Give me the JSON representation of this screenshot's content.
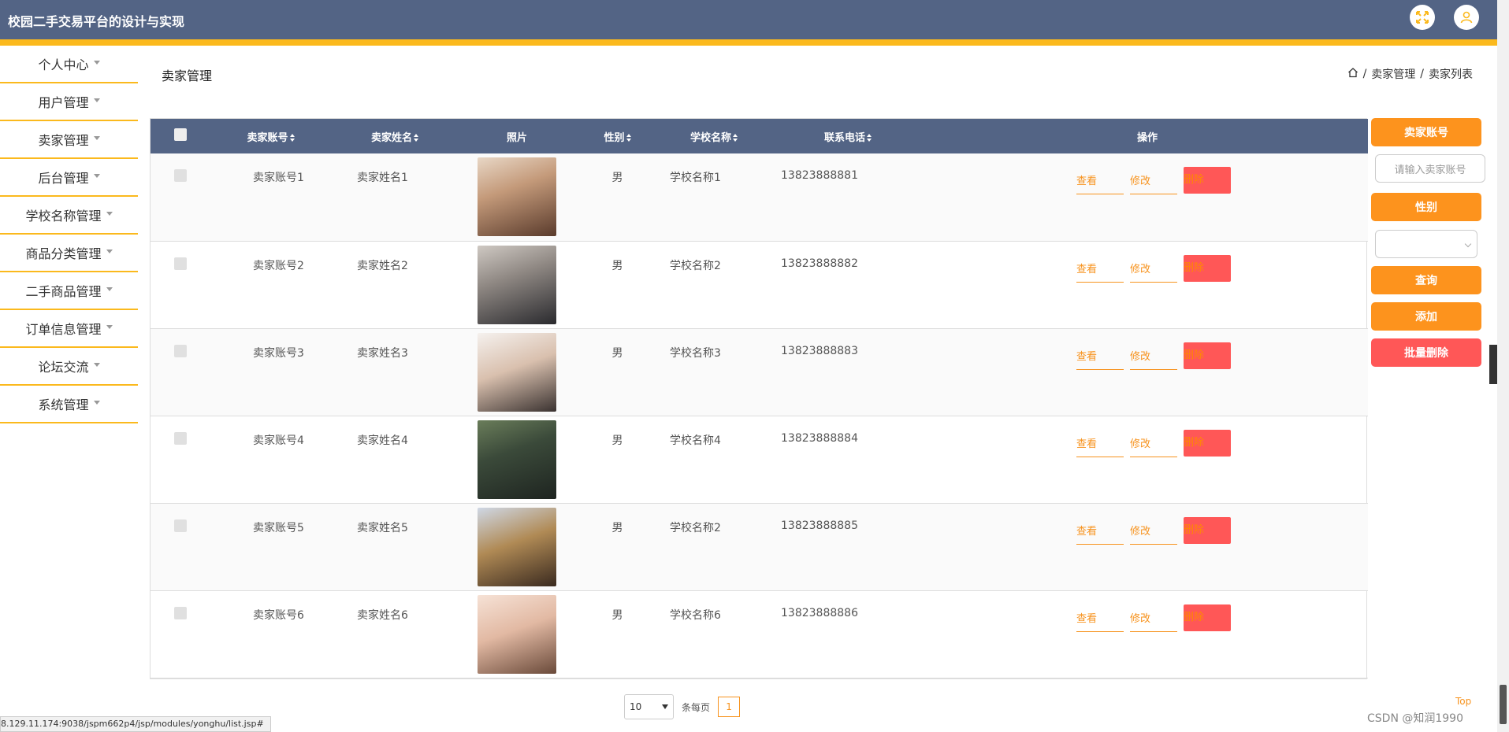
{
  "app": {
    "title": "校园二手交易平台的设计与实现"
  },
  "colors": {
    "header_bg": "#536485",
    "accent": "#fbb91d",
    "orange": "#fd931d",
    "danger": "#ff5757"
  },
  "header": {
    "icons": [
      "fullscreen-icon",
      "user-icon"
    ]
  },
  "sidebar": {
    "items": [
      {
        "label": "个人中心"
      },
      {
        "label": "用户管理"
      },
      {
        "label": "卖家管理"
      },
      {
        "label": "后台管理"
      },
      {
        "label": "学校名称管理"
      },
      {
        "label": "商品分类管理"
      },
      {
        "label": "二手商品管理"
      },
      {
        "label": "订单信息管理"
      },
      {
        "label": "论坛交流"
      },
      {
        "label": "系统管理"
      }
    ]
  },
  "page": {
    "title": "卖家管理",
    "breadcrumb": {
      "sep": "/",
      "section": "卖家管理",
      "current": "卖家列表"
    }
  },
  "table": {
    "headers": {
      "account": "卖家账号",
      "name": "卖家姓名",
      "photo": "照片",
      "gender": "性别",
      "school": "学校名称",
      "phone": "联系电话",
      "ops": "操作"
    },
    "actions": {
      "view": "查看",
      "edit": "修改",
      "delete": "删除"
    },
    "rows": [
      {
        "account": "卖家账号1",
        "name": "卖家姓名1",
        "gender": "男",
        "school": "学校名称1",
        "phone": "13823888881"
      },
      {
        "account": "卖家账号2",
        "name": "卖家姓名2",
        "gender": "男",
        "school": "学校名称2",
        "phone": "13823888882"
      },
      {
        "account": "卖家账号3",
        "name": "卖家姓名3",
        "gender": "男",
        "school": "学校名称3",
        "phone": "13823888883"
      },
      {
        "account": "卖家账号4",
        "name": "卖家姓名4",
        "gender": "男",
        "school": "学校名称4",
        "phone": "13823888884"
      },
      {
        "account": "卖家账号5",
        "name": "卖家姓名5",
        "gender": "男",
        "school": "学校名称2",
        "phone": "13823888885"
      },
      {
        "account": "卖家账号6",
        "name": "卖家姓名6",
        "gender": "男",
        "school": "学校名称6",
        "phone": "13823888886"
      }
    ]
  },
  "search": {
    "account_label": "卖家账号",
    "account_placeholder": "请输入卖家账号",
    "gender_label": "性别",
    "query": "查询",
    "add": "添加",
    "batch_delete": "批量删除"
  },
  "pagination": {
    "page_size": "10",
    "per_page_label": "条每页",
    "current_page": "1"
  },
  "misc": {
    "top": "Top",
    "status_url": "8.129.11.174:9038/jspm662p4/jsp/modules/yonghu/list.jsp#",
    "watermark": "CSDN @知润1990"
  }
}
